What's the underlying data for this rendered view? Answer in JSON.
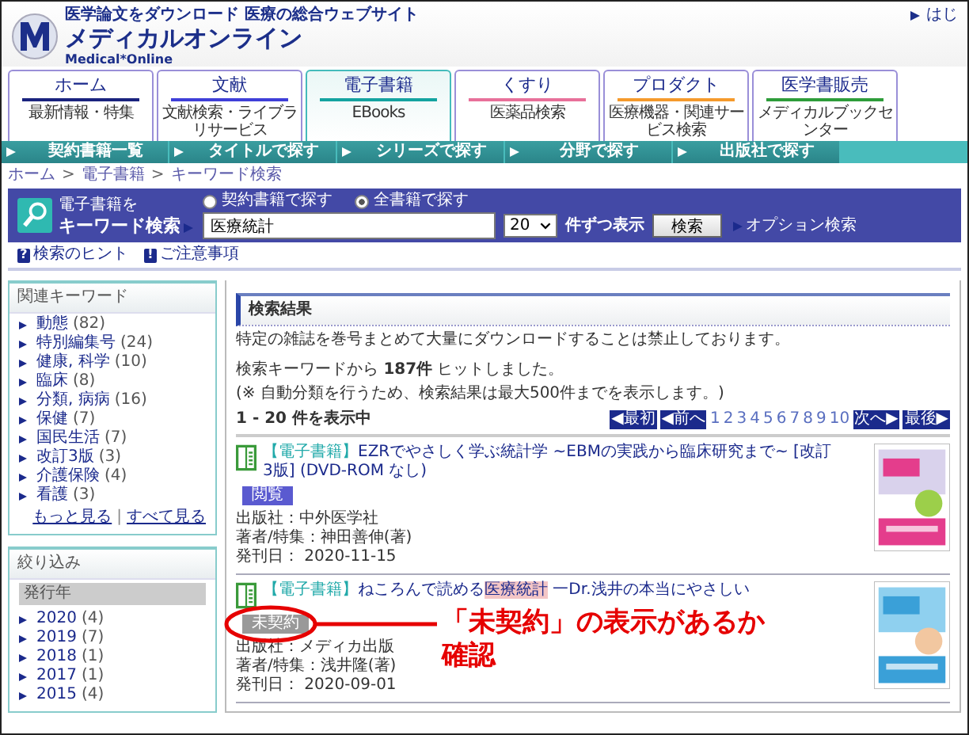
{
  "header": {
    "tagline": "医学論文をダウンロード 医療の総合ウェブサイト",
    "logo_title": "メディカルオンライン",
    "logo_sub": "Medical*Online",
    "top_link": "はじ"
  },
  "tabs": [
    {
      "label": "ホーム",
      "sublabel": "最新情報・特集",
      "selected": false,
      "color": "#1a237e"
    },
    {
      "label": "文献",
      "sublabel": "文献検索・ライブラリサービス",
      "selected": false,
      "color": "#3f3fd8"
    },
    {
      "label": "電子書籍",
      "sublabel": "EBooks",
      "selected": true,
      "color": "#14a3a0"
    },
    {
      "label": "くすり",
      "sublabel": "医薬品検索",
      "selected": false,
      "color": "#e8709a"
    },
    {
      "label": "プロダクト",
      "sublabel": "医療機器・関連サービス検索",
      "selected": false,
      "color": "#f59a2c"
    },
    {
      "label": "医学書販売",
      "sublabel": "メディカルブックセンター",
      "selected": false,
      "color": "#2e9d3a"
    }
  ],
  "nav": [
    "契約書籍一覧",
    "タイトルで探す",
    "シリーズで探す",
    "分野で探す",
    "出版社で探す"
  ],
  "breadcrumb": {
    "separator": ">",
    "items": [
      "ホーム",
      "電子書籍",
      "キーワード検索"
    ]
  },
  "search": {
    "label_top": "電子書籍を",
    "label": "キーワード検索",
    "scopes": [
      {
        "label": "契約書籍で探す",
        "selected": false
      },
      {
        "label": "全書籍で探す",
        "selected": true
      }
    ],
    "value": "医療統計",
    "per_page": "20",
    "per_page_suffix": "件ずつ表示",
    "button": "検索",
    "option_link": "オプション検索"
  },
  "help_links": [
    {
      "icon": "?",
      "label": "検索のヒント"
    },
    {
      "icon": "!",
      "label": "ご注意事項"
    }
  ],
  "keywords": {
    "title": "関連キーワード",
    "items": [
      {
        "label": "動態",
        "count": "(82)"
      },
      {
        "label": "特別編集号",
        "count": "(24)"
      },
      {
        "label": "健康, 科学",
        "count": "(10)"
      },
      {
        "label": "臨床",
        "count": "(8)"
      },
      {
        "label": "分類, 病病",
        "count": "(16)"
      },
      {
        "label": "保健",
        "count": "(7)"
      },
      {
        "label": "国民生活",
        "count": "(7)"
      },
      {
        "label": "改訂3版",
        "count": "(3)"
      },
      {
        "label": "介護保険",
        "count": "(4)"
      },
      {
        "label": "看護",
        "count": "(3)"
      }
    ],
    "links": [
      "もっと見る",
      "すべて見る"
    ],
    "link_separator": "|"
  },
  "filter": {
    "title": "絞り込み",
    "group": "発行年",
    "items": [
      {
        "label": "2020",
        "count": "(4)"
      },
      {
        "label": "2019",
        "count": "(7)"
      },
      {
        "label": "2018",
        "count": "(1)"
      },
      {
        "label": "2017",
        "count": "(1)"
      },
      {
        "label": "2015",
        "count": "(4)"
      }
    ]
  },
  "results": {
    "title": "検索結果",
    "notice": "特定の雑誌を巻号まとめて大量にダウンロードすることは禁止しております。",
    "hits": "検索キーワードから **187件** ヒットしました。",
    "note": "(※ 自動分類を行うため、検索結果は最大500件までを表示します。)",
    "range": "1 - 20 件を表示中",
    "pagination": {
      "first": "◀最初",
      "prev": "◀前へ",
      "pages": [
        "1",
        "2",
        "3",
        "4",
        "5",
        "6",
        "7",
        "8",
        "9",
        "10"
      ],
      "next": "次へ▶",
      "last": "最後▶"
    },
    "books": [
      {
        "category": "【電子書籍】",
        "segments": [
          {
            "text": "EZRでやさしく学ぶ統計学 ~EBMの実践から臨床研究まで~ [改訂3版] (DVD-ROM なし)",
            "highlight": false
          }
        ],
        "badge": {
          "label": "閲覧",
          "kind": "view"
        },
        "publisher": "出版社：中外医学社",
        "author": "著者/特集：神田善伸(著)",
        "date": "発刊日： 2020-11-15"
      },
      {
        "category": "【電子書籍】",
        "segments": [
          {
            "text": "ねころんで読める",
            "highlight": false
          },
          {
            "text": "医療統計",
            "highlight": true
          },
          {
            "text": " 一Dr.浅井の本当にやさしい",
            "highlight": false
          }
        ],
        "badge": {
          "label": "未契約",
          "kind": "uncontracted"
        },
        "publisher": "出版社：メディカ出版",
        "author": "著者/特集：浅井隆(著)",
        "date": "発刊日： 2020-09-01"
      }
    ]
  },
  "annotation": {
    "lines": [
      "「未契約」の表示があるか",
      "確認"
    ]
  }
}
